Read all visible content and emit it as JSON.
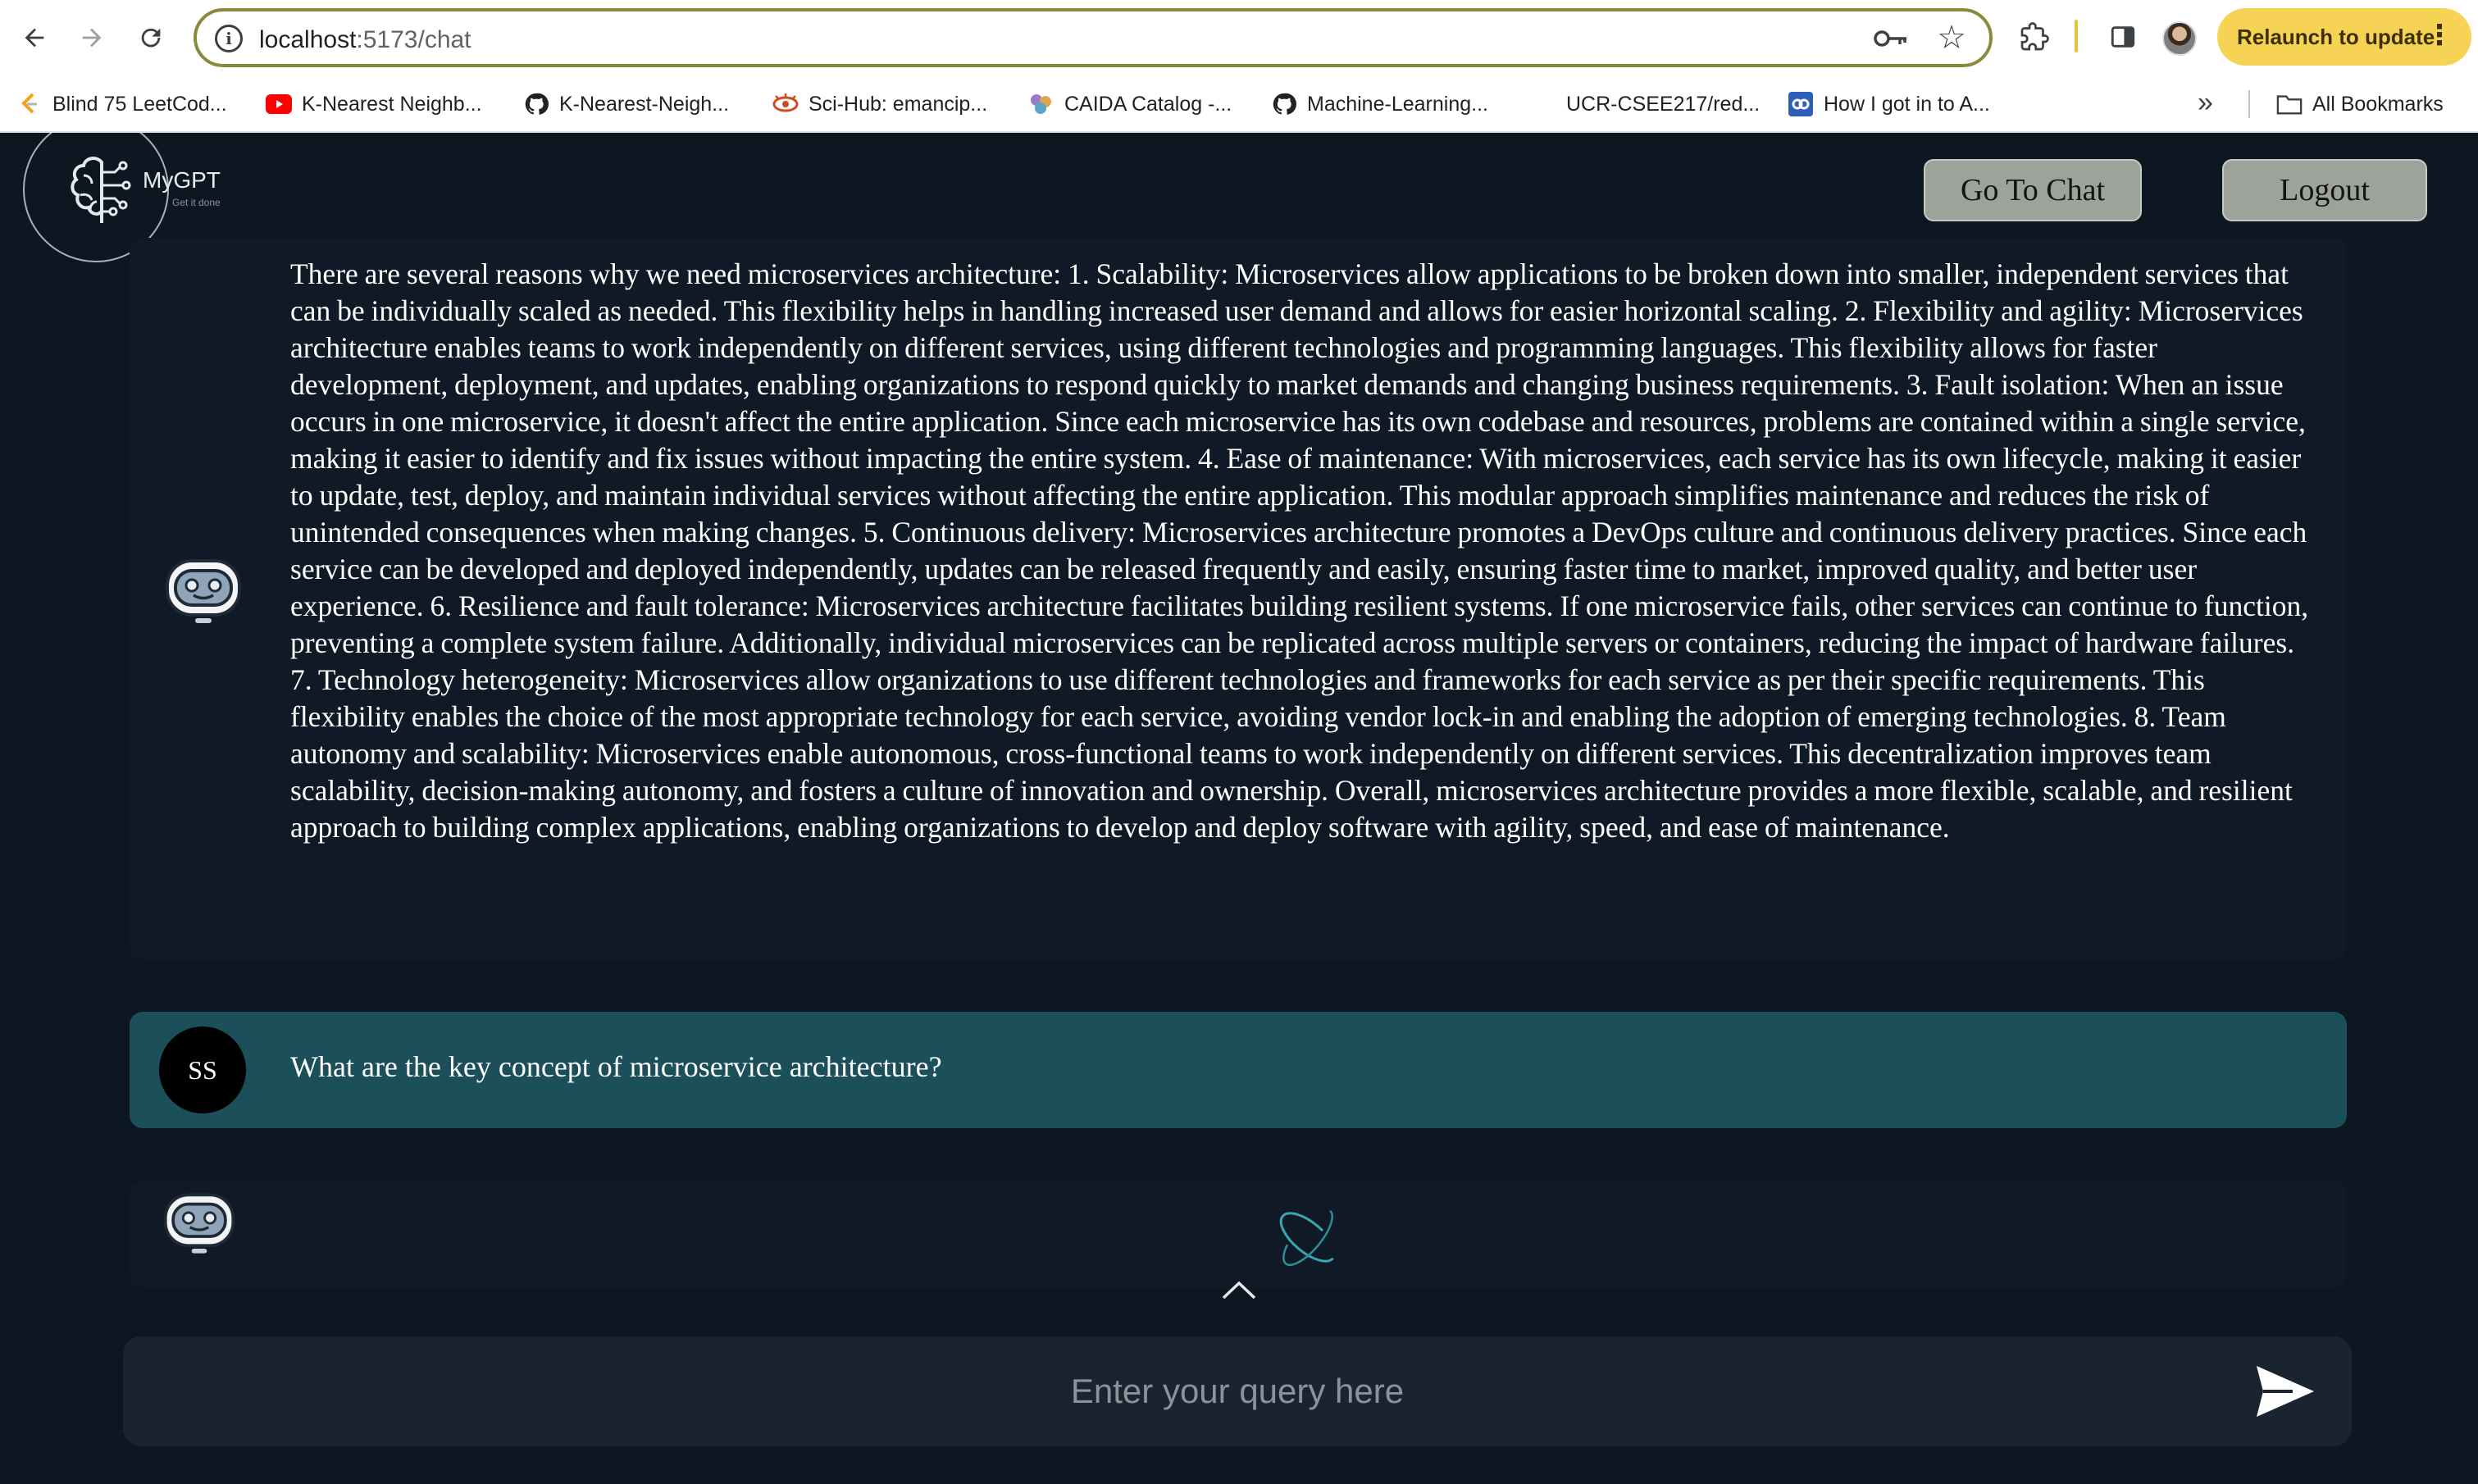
{
  "browser": {
    "url_host": "localhost",
    "url_rest": ":5173/chat",
    "relaunch_label": "Relaunch to update",
    "bookmarks": [
      {
        "label": "Blind 75 LeetCod...",
        "icon": "leetcode-icon"
      },
      {
        "label": "K-Nearest Neighb...",
        "icon": "youtube-icon"
      },
      {
        "label": "K-Nearest-Neigh...",
        "icon": "github-icon"
      },
      {
        "label": "Sci-Hub: emancip...",
        "icon": "scihub-icon"
      },
      {
        "label": "CAIDA Catalog -...",
        "icon": "caida-icon"
      },
      {
        "label": "Machine-Learning...",
        "icon": "github-icon"
      },
      {
        "label": "UCR-CSEE217/red...",
        "icon": "github-icon"
      },
      {
        "label": "How I got in to A...",
        "icon": "link-icon"
      }
    ],
    "all_bookmarks_label": "All Bookmarks"
  },
  "app": {
    "logo_name": "MyGPT",
    "logo_tagline": "Get it done",
    "go_to_chat_label": "Go To Chat",
    "logout_label": "Logout"
  },
  "chat": {
    "assistant_answer": "There are several reasons why we need microservices architecture: 1. Scalability: Microservices allow applications to be broken down into smaller, independent services that can be individually scaled as needed. This flexibility helps in handling increased user demand and allows for easier horizontal scaling. 2. Flexibility and agility: Microservices architecture enables teams to work independently on different services, using different technologies and programming languages. This flexibility allows for faster development, deployment, and updates, enabling organizations to respond quickly to market demands and changing business requirements. 3. Fault isolation: When an issue occurs in one microservice, it doesn't affect the entire application. Since each microservice has its own codebase and resources, problems are contained within a single service, making it easier to identify and fix issues without impacting the entire system. 4. Ease of maintenance: With microservices, each service has its own lifecycle, making it easier to update, test, deploy, and maintain individual services without affecting the entire application. This modular approach simplifies maintenance and reduces the risk of unintended consequences when making changes. 5. Continuous delivery: Microservices architecture promotes a DevOps culture and continuous delivery practices. Since each service can be developed and deployed independently, updates can be released frequently and easily, ensuring faster time to market, improved quality, and better user experience. 6. Resilience and fault tolerance: Microservices architecture facilitates building resilient systems. If one microservice fails, other services can continue to function, preventing a complete system failure. Additionally, individual microservices can be replicated across multiple servers or containers, reducing the impact of hardware failures. 7. Technology heterogeneity: Microservices allow organizations to use different technologies and frameworks for each service as per their specific requirements. This flexibility enables the choice of the most appropriate technology for each service, avoiding vendor lock-in and enabling the adoption of emerging technologies. 8. Team autonomy and scalability: Microservices enable autonomous, cross-functional teams to work independently on different services. This decentralization improves team scalability, decision-making autonomy, and fosters a culture of innovation and ownership. Overall, microservices architecture provides a more flexible, scalable, and resilient approach to building complex applications, enabling organizations to develop and deploy software with agility, speed, and ease of maintenance.",
    "user_initials": "SS",
    "user_question": "What are the key concept of microservice architecture?",
    "query_placeholder": "Enter your query here"
  },
  "colors": {
    "background": "#0c1722",
    "assistant_bubble": "#0f1a26",
    "user_bubble": "#1b4f59",
    "button": "#9da29a",
    "relaunch": "#f6d354",
    "loader": "#3aa6b0"
  }
}
